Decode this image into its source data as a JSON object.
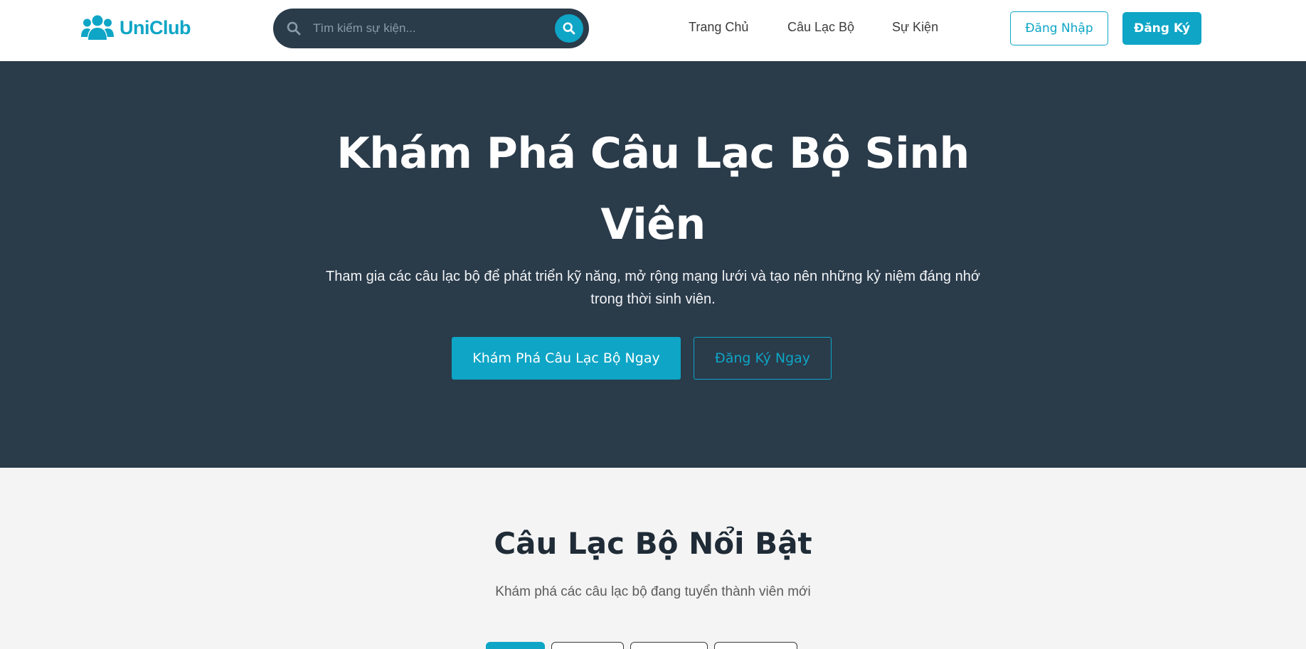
{
  "colors": {
    "accent": "#0ea5c6",
    "hero_background": "#2a3b4a",
    "page_background": "#f4f4f4"
  },
  "navbar": {
    "logo": {
      "icon": "users-icon",
      "text": "UniClub"
    },
    "search": {
      "placeholder": "Tìm kiếm sự kiện...",
      "value": "",
      "icon": "search-icon",
      "button_icon": "search-icon"
    },
    "links": [
      {
        "label": "Trang Chủ"
      },
      {
        "label": "Câu Lạc Bộ"
      },
      {
        "label": "Sự Kiện"
      }
    ],
    "login_label": "Đăng Nhập",
    "register_label": "Đăng Ký"
  },
  "hero": {
    "title": "Khám Phá Câu Lạc Bộ Sinh Viên",
    "subtitle": "Tham gia các câu lạc bộ để phát triển kỹ năng, mở rộng mạng lưới và tạo nên những kỷ niệm đáng nhớ trong thời sinh viên.",
    "primary_button": "Khám Phá Câu Lạc Bộ Ngay",
    "secondary_button": "Đăng Ký Ngay"
  },
  "featured": {
    "title": "Câu Lạc Bộ Nổi Bật",
    "subtitle": "Khám phá các câu lạc bộ đang tuyển thành viên mới",
    "active_filter_index": 0
  }
}
